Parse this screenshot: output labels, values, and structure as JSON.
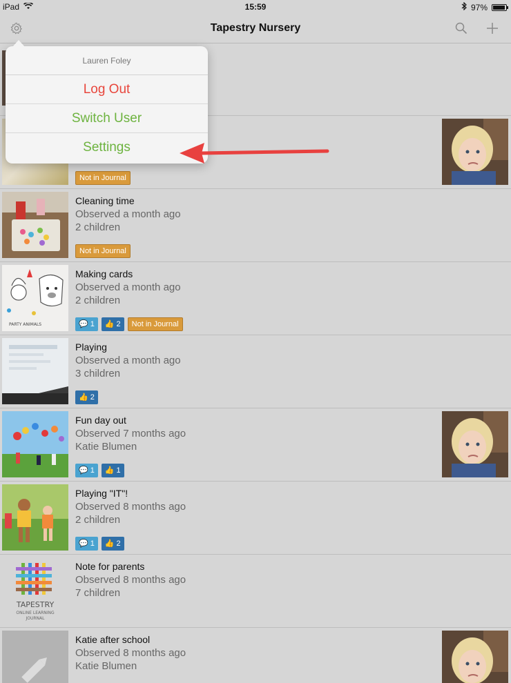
{
  "status_bar": {
    "device": "iPad",
    "time": "15:59",
    "battery": "97%",
    "battery_level": 0.97
  },
  "nav": {
    "title": "Tapestry Nursery",
    "settings_icon": "gear-icon",
    "search_icon": "search-icon",
    "add_icon": "plus-icon"
  },
  "popover": {
    "user_name": "Lauren Foley",
    "items": [
      "Log Out",
      "Switch User",
      "Settings"
    ]
  },
  "badge_text": {
    "not_in_journal": "Not in Journal"
  },
  "observations": [
    {
      "title": "",
      "observed": "",
      "children": "",
      "badges": {
        "journal": true
      }
    },
    {
      "title": "Cleaning time",
      "observed": "Observed a month ago",
      "children": "2 children",
      "badges": {
        "journal": true
      }
    },
    {
      "title": "Making cards",
      "observed": "Observed a month ago",
      "children": "2 children",
      "badges": {
        "comments": "1",
        "likes": "2",
        "journal": true
      }
    },
    {
      "title": "Playing",
      "observed": "Observed a month ago",
      "children": "3 children",
      "badges": {
        "likes": "2"
      }
    },
    {
      "title": "Fun day out",
      "observed": "Observed 7 months ago",
      "children": "Katie Blumen",
      "badges": {
        "comments": "1",
        "likes": "1"
      }
    },
    {
      "title": "Playing \"IT\"!",
      "observed": "Observed 8 months ago",
      "children": "2 children",
      "badges": {
        "comments": "1",
        "likes": "2"
      }
    },
    {
      "title": "Note for parents",
      "observed": "Observed 8 months ago",
      "children": "7 children",
      "badges": {}
    },
    {
      "title": "Katie after school",
      "observed": "Observed 8 months ago",
      "children": "Katie Blumen",
      "badges": {}
    }
  ],
  "logo": {
    "name": "TAPESTRY",
    "tagline_1": "ONLINE LEARNING",
    "tagline_2": "JOURNAL"
  },
  "colors": {
    "log_out": "#e8463c",
    "menu_green": "#6db33f",
    "journal_badge": "#d99a3b",
    "comment_badge": "#4aa3d0",
    "like_badge": "#2f6fa8",
    "arrow": "#e8413f"
  }
}
